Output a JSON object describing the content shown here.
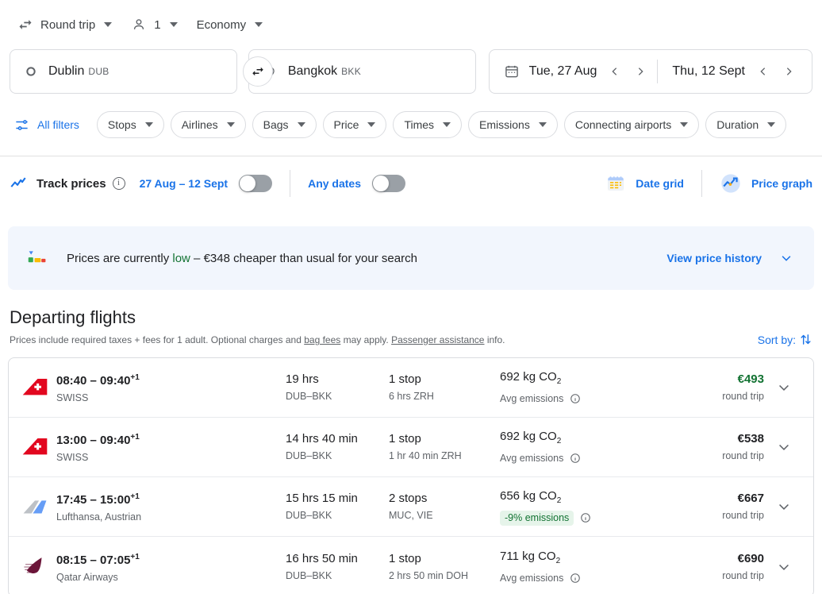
{
  "trip_bar": {
    "trip_type": "Round trip",
    "passengers": "1",
    "cabin_class": "Economy"
  },
  "search": {
    "origin_city": "Dublin",
    "origin_code": "DUB",
    "destination_city": "Bangkok",
    "destination_code": "BKK",
    "depart_date": "Tue, 27 Aug",
    "return_date": "Thu, 12 Sept"
  },
  "filters": {
    "all_filters": "All filters",
    "chips": [
      "Stops",
      "Airlines",
      "Bags",
      "Price",
      "Times",
      "Emissions",
      "Connecting airports",
      "Duration"
    ]
  },
  "track": {
    "label": "Track prices",
    "date_range": "27 Aug – 12 Sept",
    "any_dates": "Any dates",
    "date_grid": "Date grid",
    "price_graph": "Price graph"
  },
  "banner": {
    "text_before": "Prices are currently ",
    "highlight": "low",
    "text_after": " – €348 cheaper than usual for your search",
    "link": "View price history"
  },
  "departing": {
    "title": "Departing flights",
    "disclaimer_1": "Prices include required taxes + fees for 1 adult. Optional charges and ",
    "bag_fees": "bag fees",
    "disclaimer_2": " may apply. ",
    "passenger_assistance": "Passenger assistance",
    "disclaimer_3": " info.",
    "sort_by": "Sort by:"
  },
  "flights": [
    {
      "logo": "swiss",
      "times": "08:40 – 09:40",
      "day_offset": "+1",
      "airline": "SWISS",
      "duration": "19 hrs",
      "route": "DUB–BKK",
      "stops": "1 stop",
      "stop_detail": "6 hrs ZRH",
      "emissions": "692 kg CO",
      "emissions_sub": "2",
      "emissions_note": "Avg emissions",
      "emissions_badge": "",
      "price": "€493",
      "price_color": "green",
      "price_note": "round trip"
    },
    {
      "logo": "swiss",
      "times": "13:00 – 09:40",
      "day_offset": "+1",
      "airline": "SWISS",
      "duration": "14 hrs 40 min",
      "route": "DUB–BKK",
      "stops": "1 stop",
      "stop_detail": "1 hr 40 min ZRH",
      "emissions": "692 kg CO",
      "emissions_sub": "2",
      "emissions_note": "Avg emissions",
      "emissions_badge": "",
      "price": "€538",
      "price_color": "dark",
      "price_note": "round trip"
    },
    {
      "logo": "multi",
      "times": "17:45 – 15:00",
      "day_offset": "+1",
      "airline": "Lufthansa, Austrian",
      "duration": "15 hrs 15 min",
      "route": "DUB–BKK",
      "stops": "2 stops",
      "stop_detail": "MUC, VIE",
      "emissions": "656 kg CO",
      "emissions_sub": "2",
      "emissions_note": "",
      "emissions_badge": "-9% emissions",
      "price": "€667",
      "price_color": "dark",
      "price_note": "round trip"
    },
    {
      "logo": "qatar",
      "times": "08:15 – 07:05",
      "day_offset": "+1",
      "airline": "Qatar Airways",
      "duration": "16 hrs 50 min",
      "route": "DUB–BKK",
      "stops": "1 stop",
      "stop_detail": "2 hrs 50 min DOH",
      "emissions": "711 kg CO",
      "emissions_sub": "2",
      "emissions_note": "Avg emissions",
      "emissions_badge": "",
      "price": "€690",
      "price_color": "dark",
      "price_note": "round trip"
    }
  ],
  "colors": {
    "accent_blue": "#1a73e8",
    "green": "#137333",
    "banner_bg": "#f2f6fd",
    "badge_bg": "#e6f4ea",
    "border": "#dadce0"
  }
}
